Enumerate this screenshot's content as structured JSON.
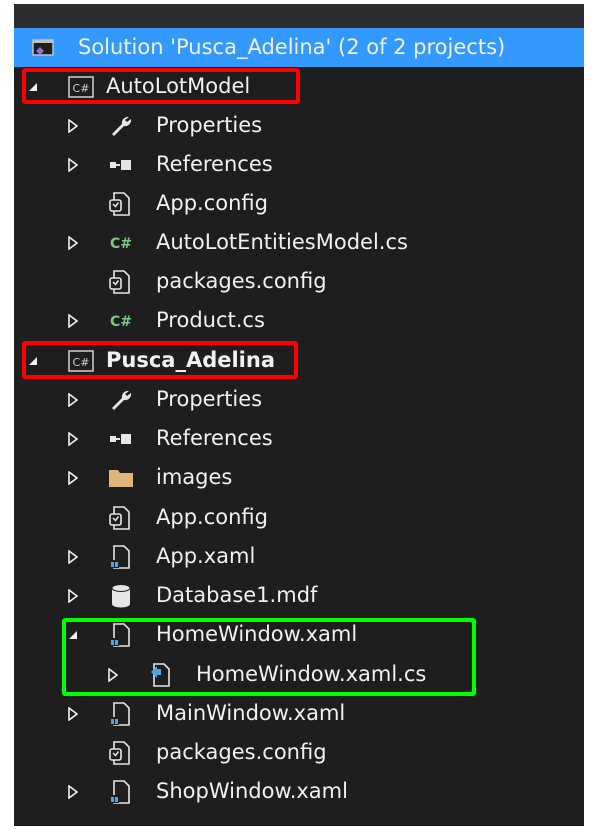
{
  "tree": {
    "solution_label": "Solution 'Pusca_Adelina' (2 of 2 projects)",
    "autolot": {
      "label": "AutoLotModel",
      "items": [
        "Properties",
        "References",
        "App.config",
        "AutoLotEntitiesModel.cs",
        "packages.config",
        "Product.cs"
      ]
    },
    "pusca": {
      "label": "Pusca_Adelina",
      "items": [
        "Properties",
        "References",
        "images",
        "App.config",
        "App.xaml",
        "Database1.mdf",
        "HomeWindow.xaml",
        "HomeWindow.xaml.cs",
        "MainWindow.xaml",
        "packages.config",
        "ShopWindow.xaml"
      ]
    }
  },
  "colors": {
    "background": "#1e1e1e",
    "selection": "#3399ff",
    "highlight_red": "#ff0000",
    "highlight_green": "#00ff00"
  }
}
